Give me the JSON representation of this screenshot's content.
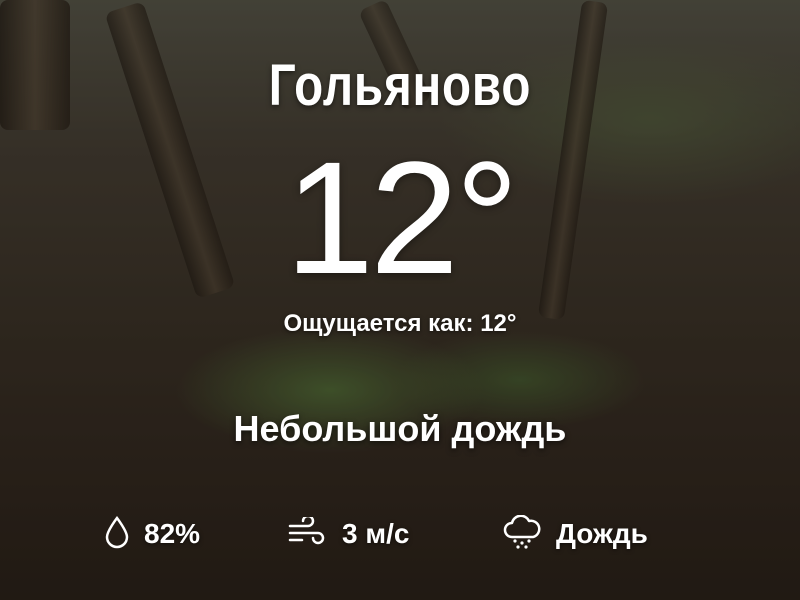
{
  "location": {
    "city": "Гольяново"
  },
  "current": {
    "temperature": "12°",
    "feels_like": "Ощущается как: 12°",
    "condition": "Небольшой дождь"
  },
  "stats": {
    "humidity": {
      "icon": "droplet-icon",
      "value": "82%"
    },
    "wind": {
      "icon": "wind-icon",
      "value": "3 м/с"
    },
    "precipitation": {
      "icon": "rain-cloud-icon",
      "value": "Дождь"
    }
  }
}
